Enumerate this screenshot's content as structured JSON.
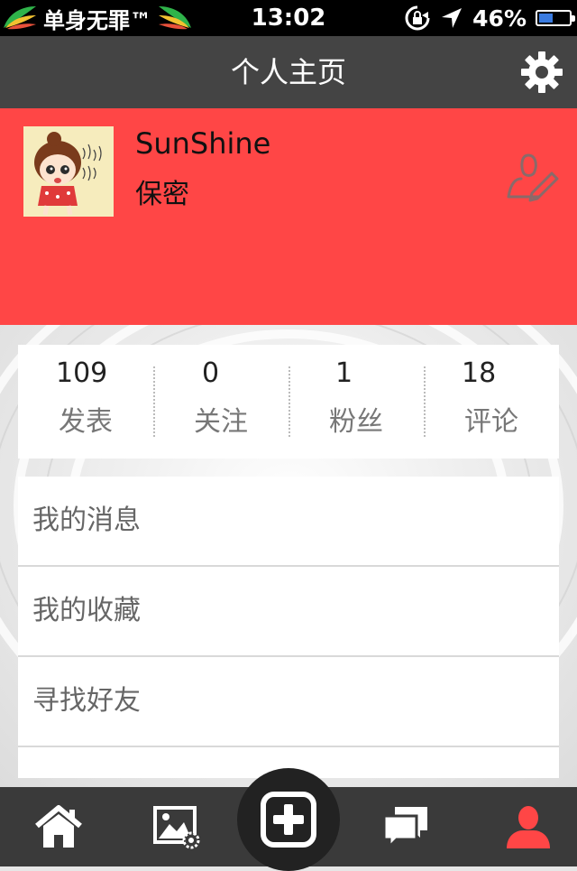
{
  "status_bar": {
    "carrier": "单身无罪™",
    "time": "13:02",
    "battery_percent": "46%",
    "battery_level": 0.46
  },
  "nav": {
    "title": "个人主页",
    "settings_icon": "gear-icon"
  },
  "profile": {
    "username": "SunShine",
    "gender": "保密",
    "edit_icon": "edit-profile-icon",
    "background_color": "#ff4646"
  },
  "stats": [
    {
      "value": "109",
      "label": "发表"
    },
    {
      "value": "0",
      "label": "关注"
    },
    {
      "value": "1",
      "label": "粉丝"
    },
    {
      "value": "18",
      "label": "评论"
    }
  ],
  "menu": [
    {
      "label": "我的消息"
    },
    {
      "label": "我的收藏"
    },
    {
      "label": "寻找好友"
    },
    {
      "label": ""
    }
  ],
  "tabbar": {
    "items": [
      {
        "icon": "home-icon"
      },
      {
        "icon": "photo-gallery-icon"
      },
      {
        "icon": "add-post-icon"
      },
      {
        "icon": "messages-icon"
      },
      {
        "icon": "profile-icon",
        "active": true
      }
    ],
    "active_color": "#ff4646"
  }
}
